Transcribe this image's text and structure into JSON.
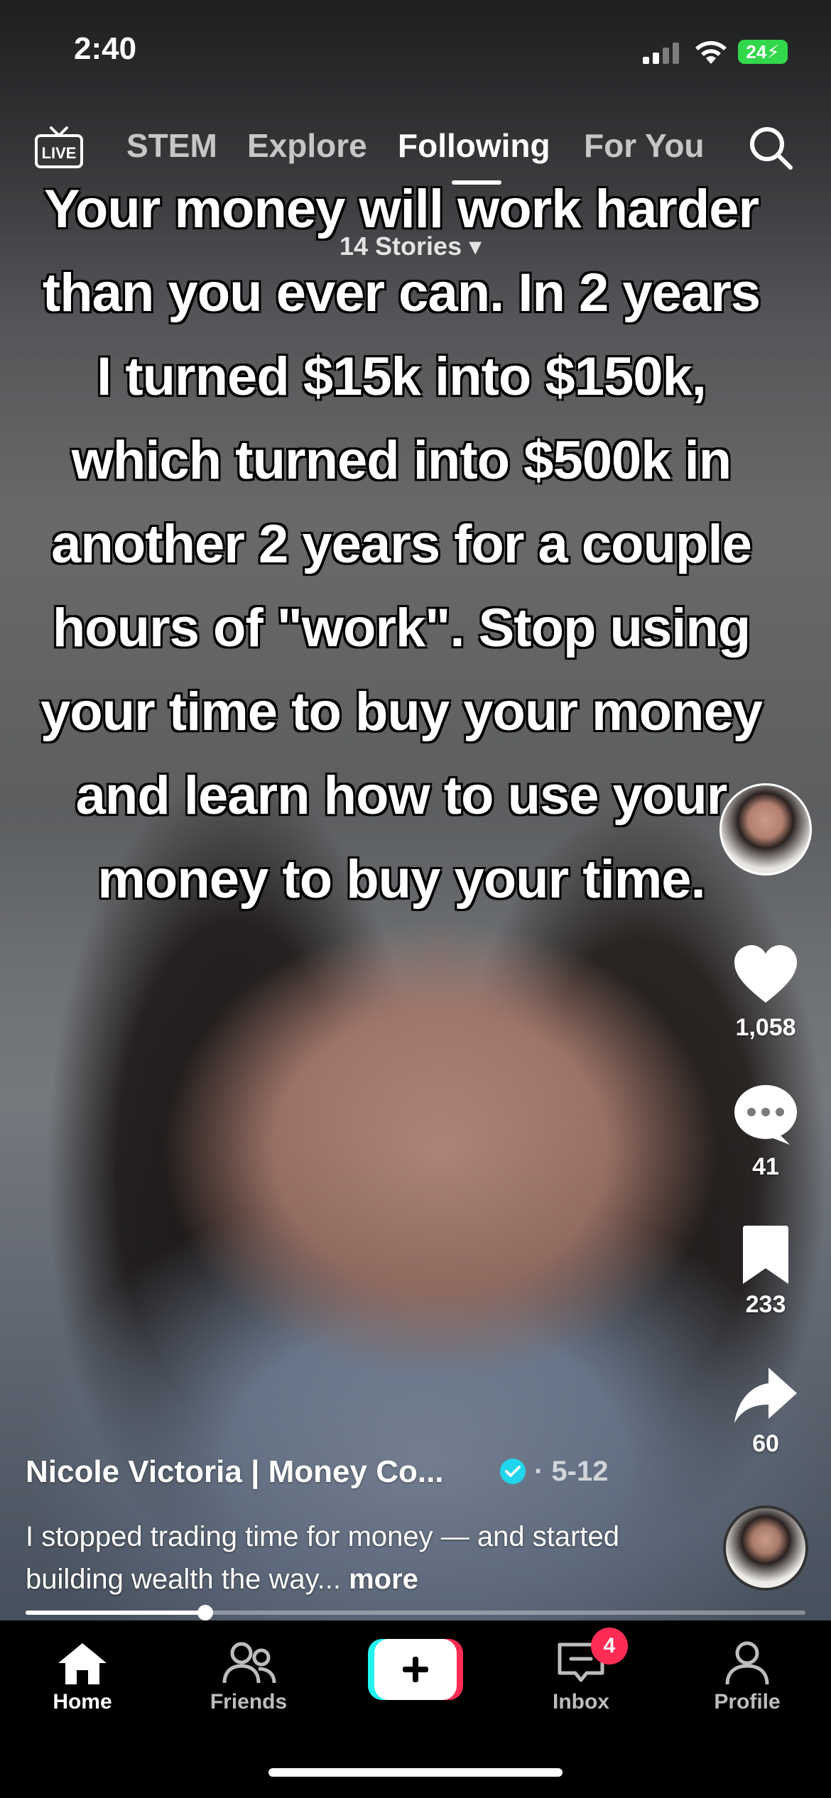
{
  "status_bar": {
    "time": "2:40",
    "battery": "24"
  },
  "top_nav": {
    "live_label": "LIVE",
    "tabs": [
      {
        "label": "STEM"
      },
      {
        "label": "Explore"
      },
      {
        "label": "Following"
      },
      {
        "label": "For You"
      }
    ],
    "stories_label": "14 Stories ▾"
  },
  "overlay_text": "Your money will work harder than you ever can. In 2 years I turned $15k into $150k, which turned into $500k in another 2 years for a couple hours of \"work\". Stop using your time to buy your money and learn how to use your money to buy your time.",
  "actions": {
    "likes": "1,058",
    "comments": "41",
    "saves": "233",
    "shares": "60"
  },
  "post": {
    "author": "Nicole Victoria | Money Co...",
    "date": "· 5-12",
    "description": "I stopped trading time for money — and started building wealth the way...",
    "more_label": "more",
    "progress": 0.23
  },
  "tabbar": {
    "home": "Home",
    "friends": "Friends",
    "inbox": "Inbox",
    "inbox_badge": "4",
    "profile": "Profile"
  },
  "colors": {
    "accent": "#fe2c55",
    "cyan": "#25f4ee",
    "battery": "#32d74b",
    "verified": "#20d5ec"
  }
}
